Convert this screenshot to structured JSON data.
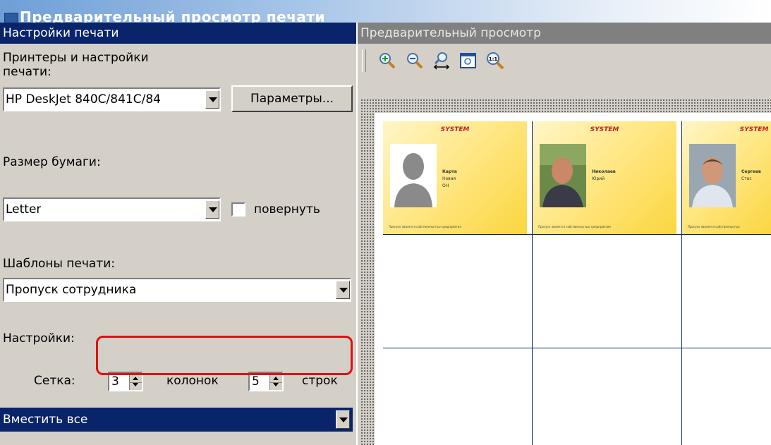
{
  "window": {
    "title": "Предварительный просмотр печати"
  },
  "left_panel": {
    "header": "Настройки печати",
    "printers_label": "Принтеры и настройки печати:",
    "printer_value": "HP DeskJet 840C/841C/84",
    "params_button": "Параметры...",
    "paper_label": "Размер бумаги:",
    "paper_value": "Letter",
    "rotate_label": "повернуть",
    "templates_label": "Шаблоны печати:",
    "template_value": "Пропуск сотрудника",
    "settings_label": "Настройки:",
    "grid_label": "Сетка:",
    "columns_value": "3",
    "columns_label": "колонок",
    "rows_value": "5",
    "rows_label": "строк",
    "fit_value": "Вместить все"
  },
  "right_panel": {
    "header": "Предварительный просмотр",
    "toolbar": [
      {
        "icon": "zoom-in-icon"
      },
      {
        "icon": "zoom-out-icon"
      },
      {
        "icon": "fit-width-icon"
      },
      {
        "icon": "fit-page-icon"
      },
      {
        "icon": "actual-size-icon",
        "text": "1:1"
      }
    ],
    "cards": [
      {
        "brand": "SYSTEM",
        "lines": [
          "Карта",
          "Новая",
          "ОН"
        ],
        "footer": "Пропуск является собственностью предприятия"
      },
      {
        "brand": "SYSTEM",
        "lines": [
          "Николаев",
          "Юрий"
        ],
        "footer": "Пропуск является собственностью предприятия"
      },
      {
        "brand": "SYSTEM",
        "lines": [
          "Сергеев",
          "Стас"
        ],
        "footer": "Пропуск является собственностью"
      }
    ]
  },
  "colors": {
    "selection": "#0a246a",
    "panel": "#d4d0c8",
    "highlight_box": "#e01010",
    "card": "#ffe680"
  }
}
